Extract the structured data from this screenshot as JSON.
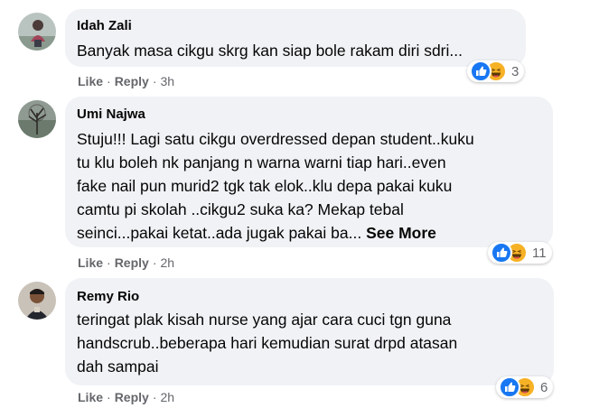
{
  "comments": [
    {
      "author": "Idah Zali",
      "lines": [
        "Banyak masa cikgu skrg kan siap bole rakam diri sdri..."
      ],
      "see_more": "",
      "like_label": "Like",
      "reply_label": "Reply",
      "time": "3h",
      "reaction_count": "3",
      "reactions": [
        "like-icon",
        "haha-icon"
      ]
    },
    {
      "author": "Umi Najwa",
      "lines": [
        "Stuju!!! Lagi satu cikgu overdressed depan student..kuku",
        "tu klu boleh nk panjang n warna warni tiap hari..even",
        "fake nail pun murid2 tgk tak elok..klu depa pakai kuku",
        "camtu pi skolah ..cikgu2 suka ka? Mekap tebal",
        "seinci...pakai ketat..ada jugak pakai ba..."
      ],
      "see_more": "See More",
      "like_label": "Like",
      "reply_label": "Reply",
      "time": "2h",
      "reaction_count": "11",
      "reactions": [
        "like-icon",
        "haha-icon"
      ]
    },
    {
      "author": "Remy Rio",
      "lines": [
        "teringat plak kisah nurse yang ajar cara cuci tgn guna",
        "handscrub..beberapa hari kemudian surat drpd atasan",
        "dah sampai"
      ],
      "see_more": "",
      "like_label": "Like",
      "reply_label": "Reply",
      "time": "2h",
      "reaction_count": "6",
      "reactions": [
        "like-icon",
        "haha-icon"
      ]
    }
  ],
  "separator": "·",
  "colors": {
    "bubble": "#f0f2f5",
    "text": "#050505",
    "meta": "#65676b",
    "like_blue": "#1877f2",
    "haha_yellow": "#f7b125"
  }
}
